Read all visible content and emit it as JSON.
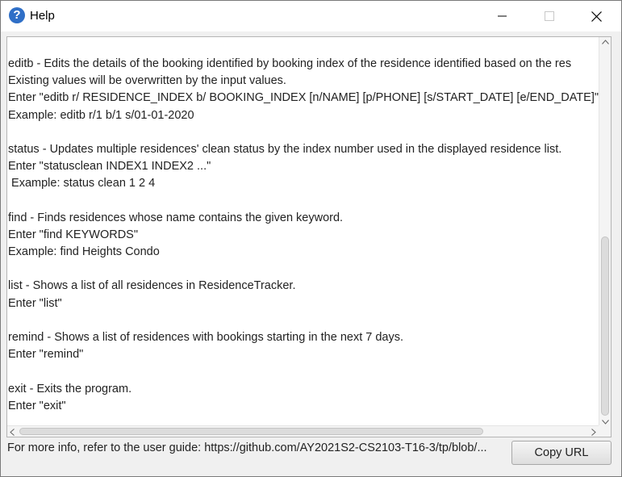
{
  "window": {
    "title": "Help",
    "icon": "question-mark-icon"
  },
  "help_text": {
    "lines": [
      "editb - Edits the details of the booking identified by booking index of the residence identified based on the res",
      "Existing values will be overwritten by the input values.",
      "Enter \"editb r/ RESIDENCE_INDEX b/ BOOKING_INDEX [n/NAME] [p/PHONE] [s/START_DATE] [e/END_DATE]\"",
      "Example: editb r/1 b/1 s/01-01-2020",
      "",
      "status - Updates multiple residences' clean status by the index number used in the displayed residence list.",
      "Enter \"statusclean INDEX1 INDEX2 ...\"",
      " Example: status clean 1 2 4",
      "",
      "find - Finds residences whose name contains the given keyword.",
      "Enter \"find KEYWORDS\"",
      "Example: find Heights Condo",
      "",
      "list - Shows a list of all residences in ResidenceTracker.",
      "Enter \"list\"",
      "",
      "remind - Shows a list of residences with bookings starting in the next 7 days.",
      "Enter \"remind\"",
      "",
      "exit - Exits the program.",
      "Enter \"exit\""
    ]
  },
  "footer": {
    "info_text": "For more info, refer to the user guide: https://github.com/AY2021S2-CS2103-T16-3/tp/blob/...",
    "copy_button_label": "Copy URL"
  }
}
